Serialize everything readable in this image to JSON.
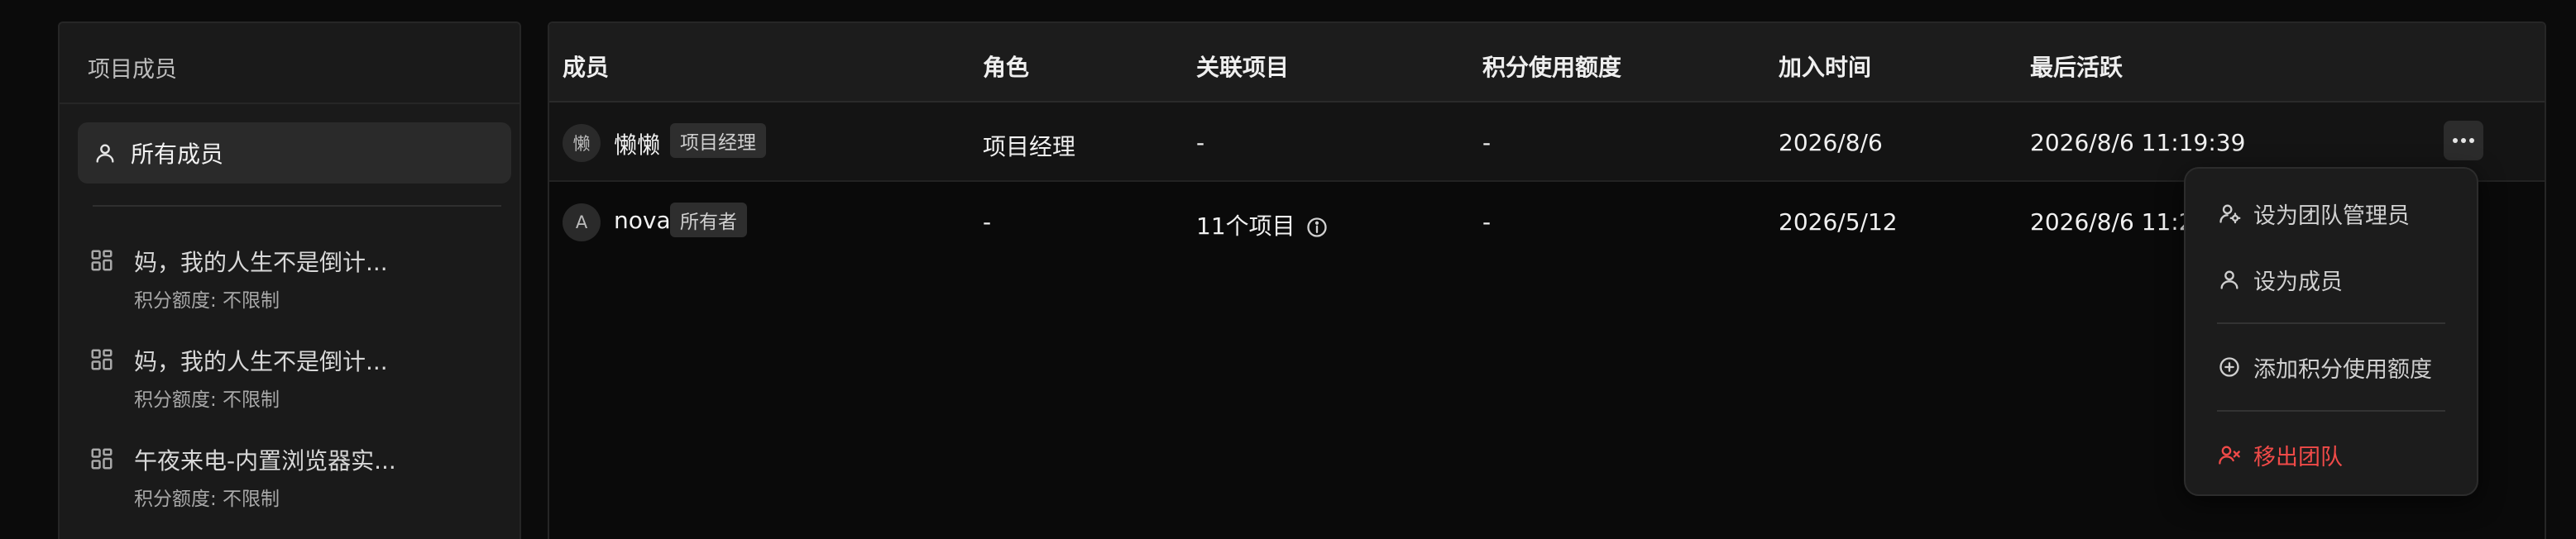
{
  "sidebar": {
    "title": "项目成员",
    "all_members_label": "所有成员",
    "projects": [
      {
        "name": "妈，我的人生不是倒计...",
        "quota": "积分额度: 不限制"
      },
      {
        "name": "妈，我的人生不是倒计...",
        "quota": "积分额度: 不限制"
      },
      {
        "name": "午夜来电-内置浏览器实...",
        "quota": "积分额度: 不限制"
      }
    ]
  },
  "table": {
    "columns": [
      "成员",
      "角色",
      "关联项目",
      "积分使用额度",
      "加入时间",
      "最后活跃"
    ],
    "rows": [
      {
        "avatar": "懒",
        "name": "懒懒",
        "badge": "项目经理",
        "role": "项目经理",
        "projects": "-",
        "quota": "-",
        "joined": "2026/8/6",
        "last_active": "2026/8/6 11:19:39"
      },
      {
        "avatar": "A",
        "name": "nova",
        "badge": "所有者",
        "role": "-",
        "projects": "11个项目",
        "quota": "-",
        "joined": "2026/5/12",
        "last_active": "2026/8/6 11:20"
      }
    ]
  },
  "dropdown": {
    "items": [
      {
        "label": "设为团队管理员",
        "icon": "user-gear-icon"
      },
      {
        "label": "设为成员",
        "icon": "user-icon"
      },
      {
        "label": "添加积分使用额度",
        "icon": "plus-circle-icon"
      },
      {
        "label": "移出团队",
        "icon": "user-remove-icon",
        "color": "#f04a48"
      }
    ]
  }
}
